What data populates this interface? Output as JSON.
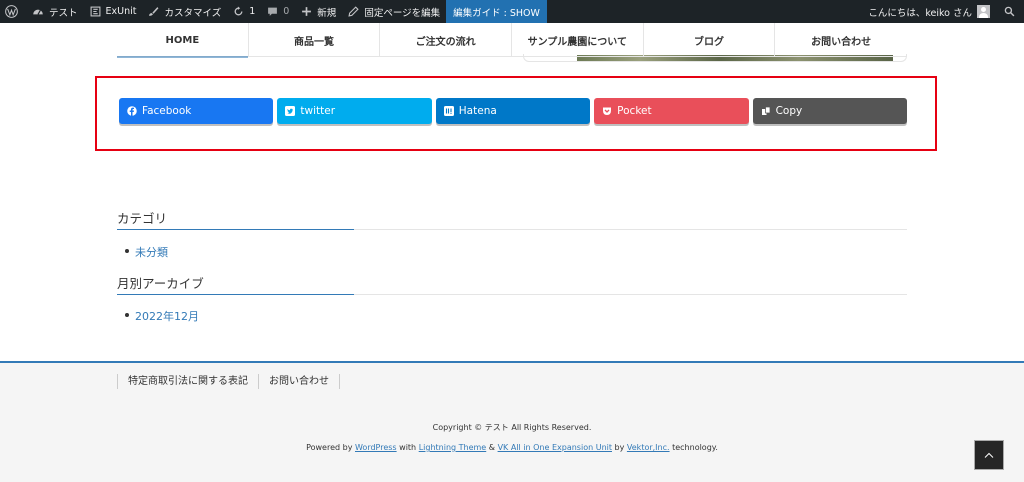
{
  "admin_bar": {
    "site_name": "テスト",
    "exunit": "ExUnit",
    "customize": "カスタマイズ",
    "updates_count": "1",
    "comments_count": "0",
    "new_label": "新規",
    "edit_page": "固定ページを編集",
    "guide": "編集ガイド : SHOW",
    "greeting": "こんにちは、keiko さん"
  },
  "nav": {
    "items": [
      {
        "label": "HOME"
      },
      {
        "label": "商品一覧"
      },
      {
        "label": "ご注文の流れ"
      },
      {
        "label": "サンプル農園について"
      },
      {
        "label": "ブログ"
      },
      {
        "label": "お問い合わせ"
      }
    ]
  },
  "share": {
    "buttons": [
      {
        "label": "Facebook",
        "color": "#1877f2",
        "icon": "facebook-icon"
      },
      {
        "label": "twitter",
        "color": "#00acee",
        "icon": "twitter-icon"
      },
      {
        "label": "Hatena",
        "color": "#0078c8",
        "icon": "hatena-icon"
      },
      {
        "label": "Pocket",
        "color": "#e94f5a",
        "icon": "pocket-icon"
      },
      {
        "label": "Copy",
        "color": "#555555",
        "icon": "copy-icon"
      }
    ],
    "highlight_color": "#e60012"
  },
  "sidebar": {
    "categories_title": "カテゴリ",
    "categories": [
      "未分類"
    ],
    "archives_title": "月別アーカイブ",
    "archives": [
      "2022年12月"
    ]
  },
  "footer": {
    "nav": [
      "特定商取引法に関する表記",
      "お問い合わせ"
    ],
    "copyright": "Copyright © テスト All Rights Reserved.",
    "powered": {
      "prefix": "Powered by",
      "wordpress": "WordPress",
      "with": "with",
      "theme": "Lightning Theme",
      "amp": "&",
      "vk": "VK All in One Expansion Unit",
      "by": "by",
      "vektor": "Vektor,Inc.",
      "suffix": "technology."
    }
  },
  "colors": {
    "accent": "#337ab7",
    "admin_bar": "#1d2327"
  }
}
